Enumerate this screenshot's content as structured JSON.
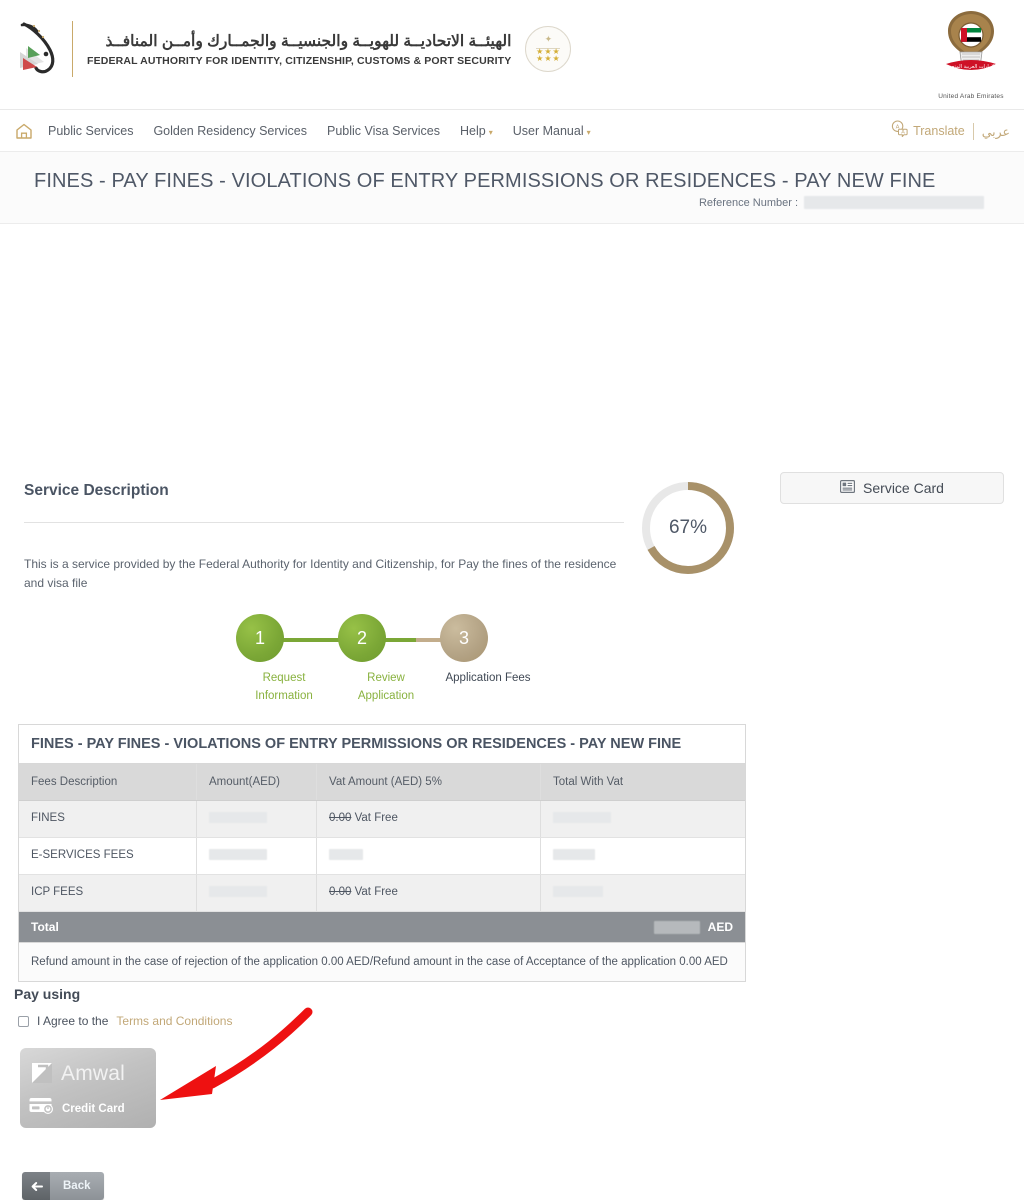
{
  "header": {
    "brand_ar": "الهيئــة الاتحاديــة للهويــة والجنسيــة والجمــارك وأمــن المنافــذ",
    "brand_en": "FEDERAL AUTHORITY FOR IDENTITY, CITIZENSHIP, CUSTOMS & PORT SECURITY",
    "seal_icon": "quality-seal-icon",
    "falcon_icon": "falcon-logo-icon",
    "emblem_icon": "uae-emblem-icon",
    "emblem_label": "United Arab Emirates"
  },
  "nav": {
    "home_icon": "home-icon",
    "items": [
      {
        "label": "Public Services",
        "caret": ""
      },
      {
        "label": "Golden Residency Services",
        "caret": ""
      },
      {
        "label": "Public Visa Services",
        "caret": ""
      },
      {
        "label": "Help",
        "caret": "▾"
      },
      {
        "label": "User Manual",
        "caret": "▾"
      }
    ],
    "translate_icon": "translate-icon",
    "translate_label": "Translate",
    "arabic_label": "عربي"
  },
  "title_band": {
    "page_title": "FINES - PAY FINES - VIOLATIONS OF ENTRY PERMISSIONS OR RESIDENCES - PAY NEW FINE",
    "reference_label": "Reference Number :",
    "reference_value": ""
  },
  "service": {
    "heading": "Service Description",
    "body": "This is a service provided by the Federal Authority for Identity and Citizenship, for Pay the fines of the residence and visa file",
    "progress_percent": "67%",
    "progress_value": 67,
    "progress_color": "#a89169",
    "progress_track_color": "#e8e8e8"
  },
  "service_card_button": {
    "label": "Service Card",
    "icon": "card-list-icon"
  },
  "stepper": {
    "steps": [
      {
        "number": "1",
        "caption": "Request Information",
        "state": "done"
      },
      {
        "number": "2",
        "caption": "Review Application",
        "state": "done"
      },
      {
        "number": "3",
        "caption": "Application Fees",
        "state": "current"
      }
    ],
    "done_color": "#7ba736",
    "current_color": "#b3a284"
  },
  "fees_table": {
    "title": "FINES - PAY FINES - VIOLATIONS OF ENTRY PERMISSIONS OR RESIDENCES - PAY NEW FINE",
    "columns": [
      "Fees Description",
      "Amount(AED)",
      "Vat Amount (AED) 5%",
      "Total With Vat"
    ],
    "rows": [
      {
        "desc": "FINES",
        "amount": "",
        "vat_strike": "0.00",
        "vat_text": "Vat Free",
        "total": ""
      },
      {
        "desc": "E-SERVICES FEES",
        "amount": "",
        "vat_strike": "",
        "vat_text": "",
        "total": ""
      },
      {
        "desc": "ICP FEES",
        "amount": "",
        "vat_strike": "0.00",
        "vat_text": "Vat Free",
        "total": ""
      }
    ],
    "total_label": "Total",
    "total_value": "",
    "total_currency": "AED",
    "note": "Refund amount in the case of rejection of the application 0.00 AED/Refund amount in the case of Acceptance of the application 0.00 AED"
  },
  "payment": {
    "pay_using_label": "Pay using",
    "agree_prefix": "I Agree to the",
    "terms_label": "Terms and Conditions",
    "agree_checked": false,
    "amwal": {
      "brand": "Amwal",
      "brand_icon": "amwal-logo-icon",
      "card_icon": "credit-card-icon",
      "card_label": "Credit Card"
    }
  },
  "footer": {
    "back_label": "Back",
    "back_icon": "arrow-left-icon"
  },
  "annotation": {
    "arrow_color": "#ee1111",
    "arrow_name": "annotation-arrow"
  }
}
